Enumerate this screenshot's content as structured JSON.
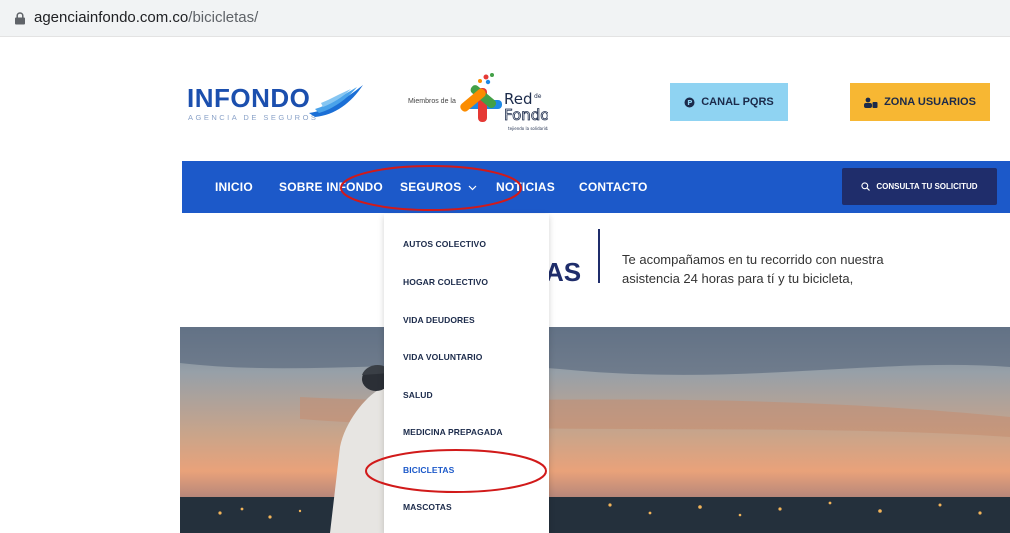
{
  "browser": {
    "url_domain": "agenciainfondo.com.co",
    "url_path": "/bicicletas/"
  },
  "header": {
    "brand_name": "INFONDO",
    "brand_tagline": "AGENCIA DE SEGUROS",
    "partner_prefix": "Miembros de la",
    "partner_name": "Red de Fondos",
    "partner_slogan": "tejiendo la solidaridad",
    "pqrs_label": "CANAL PQRS",
    "zona_label": "ZONA USUARIOS"
  },
  "nav": {
    "items": [
      "INICIO",
      "SOBRE INFONDO",
      "SEGUROS",
      "NOTICIAS",
      "CONTACTO"
    ],
    "search_label": "CONSULTA TU SOLICITUD"
  },
  "dropdown": {
    "items": [
      "AUTOS COLECTIVO",
      "HOGAR COLECTIVO",
      "VIDA DEUDORES",
      "VIDA VOLUNTARIO",
      "SALUD",
      "MEDICINA PREPAGADA",
      "BICICLETAS",
      "MASCOTAS"
    ],
    "active_index": 6
  },
  "page": {
    "title_fragment": "AS",
    "intro_text": "Te acompañamos en tu recorrido con nuestra asistencia 24 horas para tí y tu bicicleta,"
  },
  "colors": {
    "nav_bg": "#1c59c9",
    "brand_blue": "#1b4fae",
    "pqrs_bg": "#8fd3f2",
    "zona_bg": "#f7b733",
    "search_bg": "#1f2d6b",
    "annotation": "#d11a1a"
  },
  "icons": {
    "lock": "lock-icon",
    "pqrs": "chat-p-icon",
    "zona": "users-icon",
    "search": "search-icon",
    "chevron": "chevron-down-icon"
  }
}
